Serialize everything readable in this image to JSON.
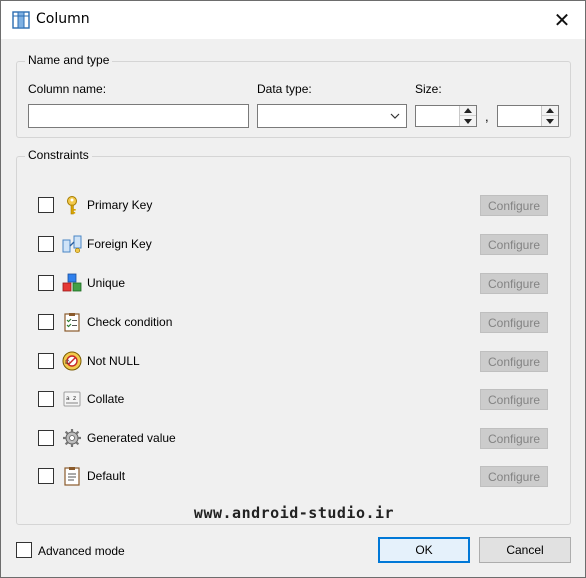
{
  "window": {
    "title": "Column",
    "icon": "column-table-icon",
    "close_glyph": "✕"
  },
  "name_and_type": {
    "group_label": "Name and type",
    "column_name_label": "Column name:",
    "column_name_value": "",
    "data_type_label": "Data type:",
    "data_type_value": "",
    "size_label": "Size:",
    "size_value_1": "",
    "size_value_2": "",
    "separator": ","
  },
  "constraints": {
    "group_label": "Constraints",
    "items": [
      {
        "label": "Primary Key",
        "icon": "key-icon",
        "checked": false,
        "configure": "Configure"
      },
      {
        "label": "Foreign Key",
        "icon": "foreign-key-icon",
        "checked": false,
        "configure": "Configure"
      },
      {
        "label": "Unique",
        "icon": "unique-blocks-icon",
        "checked": false,
        "configure": "Configure"
      },
      {
        "label": "Check condition",
        "icon": "check-clipboard-icon",
        "checked": false,
        "configure": "Configure"
      },
      {
        "label": "Not NULL",
        "icon": "not-null-icon",
        "checked": false,
        "configure": "Configure"
      },
      {
        "label": "Collate",
        "icon": "collate-icon",
        "checked": false,
        "configure": "Configure"
      },
      {
        "label": "Generated value",
        "icon": "gear-icon",
        "checked": false,
        "configure": "Configure"
      },
      {
        "label": "Default",
        "icon": "default-clipboard-icon",
        "checked": false,
        "configure": "Configure"
      }
    ]
  },
  "watermark": "www.android-studio.ir",
  "footer": {
    "advanced_mode_label": "Advanced mode",
    "advanced_mode_checked": false,
    "ok_label": "OK",
    "cancel_label": "Cancel"
  }
}
